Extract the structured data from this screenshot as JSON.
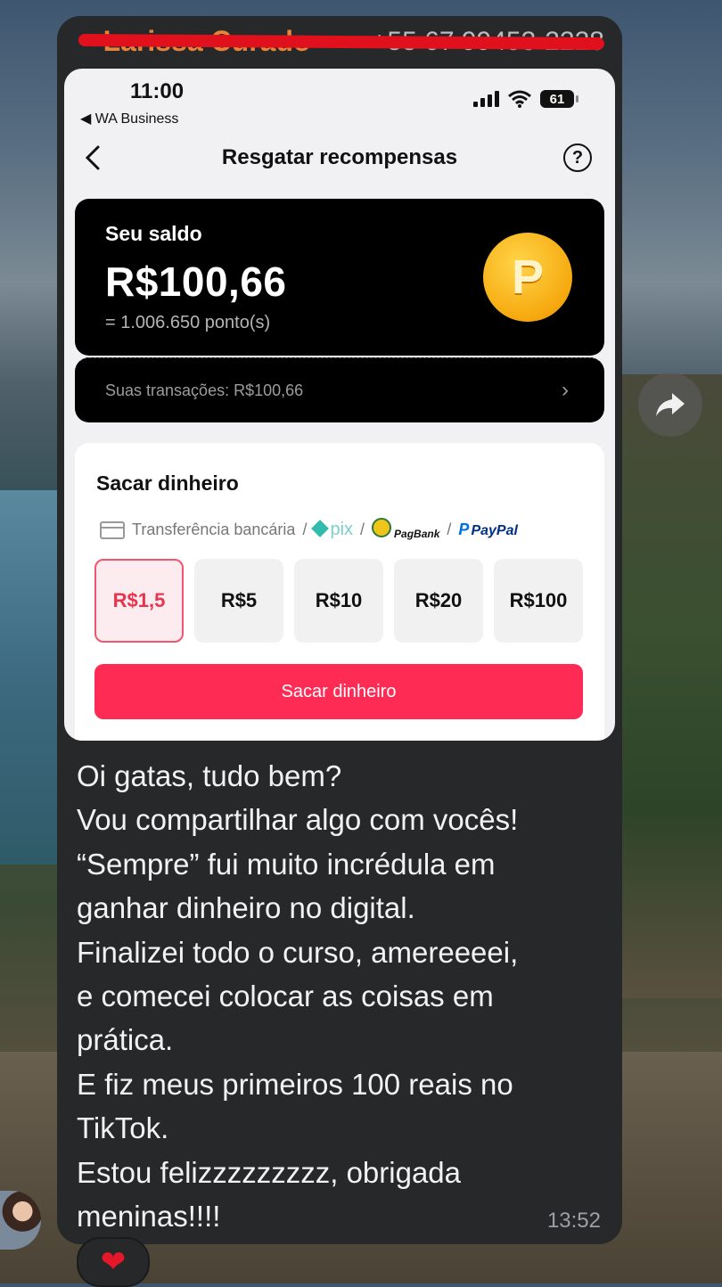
{
  "sender": {
    "name": "~ Larissa Curado",
    "phone": "+55 67 99453-2228"
  },
  "screenshot": {
    "status_time": "11:00",
    "status_back": "◀ WA Business",
    "battery": "61",
    "nav_title": "Resgatar recompensas",
    "nav_help": "?",
    "balance": {
      "label": "Seu saldo",
      "value": "R$100,66",
      "points": "= 1.006.650 ponto(s)",
      "coin_letter": "P"
    },
    "transactions": {
      "label": "Suas transações: R$100,66",
      "chevron": "›"
    },
    "withdraw": {
      "title": "Sacar dinheiro",
      "method_bank": "Transferência bancária",
      "sep": "/",
      "method_pix": "pix",
      "method_pagbank": "PagBank",
      "method_paypal_p": "P",
      "method_paypal": "PayPal",
      "amounts": [
        "R$1,5",
        "R$5",
        "R$10",
        "R$20",
        "R$100"
      ],
      "selected_amount": "R$1,5",
      "button": "Sacar dinheiro"
    }
  },
  "message": {
    "lines": [
      "Oi gatas, tudo bem?",
      "Vou compartilhar algo com vocês!",
      "“Sempre” fui muito incrédula em",
      "ganhar dinheiro no digital.",
      "Finalizei todo o curso, amereeeei,",
      "e comecei colocar as coisas em",
      "prática.",
      "E fiz meus primeiros 100 reais no",
      "TikTok.",
      "Estou felizzzzzzzzz, obrigada",
      "meninas!!!!"
    ],
    "time": "13:52"
  },
  "reaction": "❤",
  "colors": {
    "accent": "#fe2c55",
    "bubble": "#262829",
    "coin": "#f6a90e"
  }
}
